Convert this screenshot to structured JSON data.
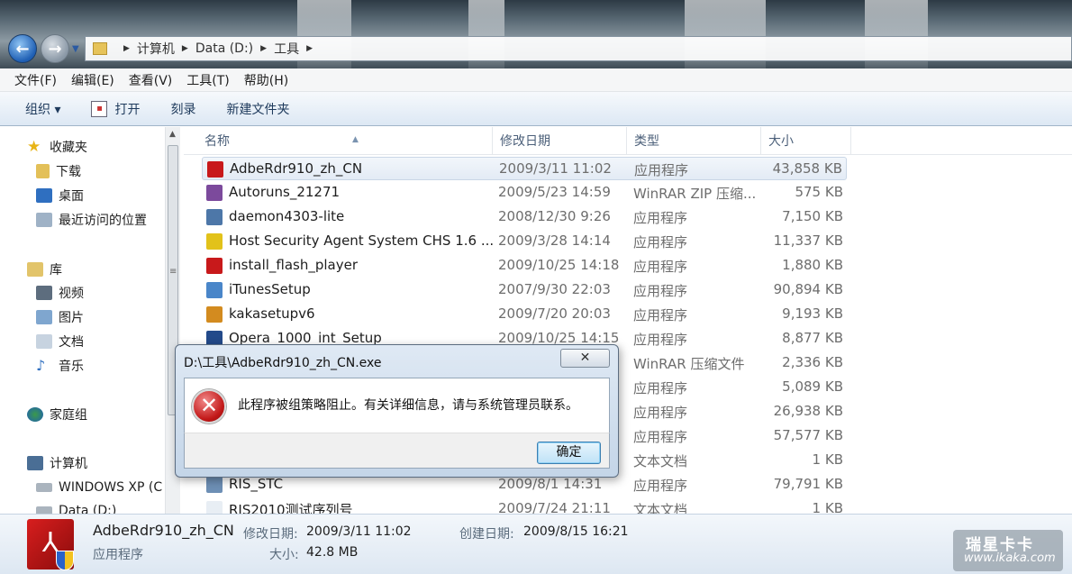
{
  "address_bar": {
    "crumbs": [
      "计算机",
      "Data (D:)",
      "工具"
    ]
  },
  "menu": [
    "文件(F)",
    "编辑(E)",
    "查看(V)",
    "工具(T)",
    "帮助(H)"
  ],
  "toolbar": {
    "organize": "组织 ▾",
    "open": "打开",
    "burn": "刻录",
    "new_folder": "新建文件夹"
  },
  "nav": {
    "favorites": "收藏夹",
    "downloads": "下载",
    "desktop": "桌面",
    "recent": "最近访问的位置",
    "libraries": "库",
    "videos": "视频",
    "pictures": "图片",
    "documents": "文档",
    "music": "音乐",
    "homegroup": "家庭组",
    "computer": "计算机",
    "drive_c": "WINDOWS XP (C",
    "drive_d": "Data (D:)"
  },
  "columns": {
    "name": "名称",
    "date": "修改日期",
    "type": "类型",
    "size": "大小"
  },
  "files": [
    {
      "name": "AdbeRdr910_zh_CN",
      "date": "2009/3/11 11:02",
      "type": "应用程序",
      "size": "43,858 KB"
    },
    {
      "name": "Autoruns_21271",
      "date": "2009/5/23 14:59",
      "type": "WinRAR ZIP 压缩...",
      "size": "575 KB"
    },
    {
      "name": "daemon4303-lite",
      "date": "2008/12/30 9:26",
      "type": "应用程序",
      "size": "7,150 KB"
    },
    {
      "name": "Host Security Agent System CHS 1.6 ...",
      "date": "2009/3/28 14:14",
      "type": "应用程序",
      "size": "11,337 KB"
    },
    {
      "name": "install_flash_player",
      "date": "2009/10/25 14:18",
      "type": "应用程序",
      "size": "1,880 KB"
    },
    {
      "name": "iTunesSetup",
      "date": "2007/9/30 22:03",
      "type": "应用程序",
      "size": "90,894 KB"
    },
    {
      "name": "kakasetupv6",
      "date": "2009/7/20 20:03",
      "type": "应用程序",
      "size": "9,193 KB"
    },
    {
      "name": "Opera_1000_int_Setup",
      "date": "2009/10/25 14:15",
      "type": "应用程序",
      "size": "8,877 KB"
    },
    {
      "name": "",
      "date": "",
      "type": "WinRAR 压缩文件",
      "size": "2,336 KB"
    },
    {
      "name": "",
      "date": "",
      "type": "应用程序",
      "size": "5,089 KB"
    },
    {
      "name": "",
      "date": "",
      "type": "应用程序",
      "size": "26,938 KB"
    },
    {
      "name": "",
      "date": "",
      "type": "应用程序",
      "size": "57,577 KB"
    },
    {
      "name": "",
      "date": "",
      "type": "文本文档",
      "size": "1 KB"
    },
    {
      "name": "RIS_STC",
      "date": "2009/8/1 14:31",
      "type": "应用程序",
      "size": "79,791 KB"
    },
    {
      "name": "RIS2010测试序列号",
      "date": "2009/7/24 21:11",
      "type": "文本文档",
      "size": "1 KB"
    }
  ],
  "details": {
    "name": "AdbeRdr910_zh_CN",
    "type": "应用程序",
    "modified_label": "修改日期:",
    "modified": "2009/3/11 11:02",
    "created_label": "创建日期:",
    "created": "2009/8/15 16:21",
    "size_label": "大小:",
    "size": "42.8 MB"
  },
  "dialog": {
    "title": "D:\\工具\\AdbeRdr910_zh_CN.exe",
    "message": "此程序被组策略阻止。有关详细信息，请与系统管理员联系。",
    "ok": "确定",
    "close": "✕"
  },
  "watermark": {
    "brand": "瑞星卡卡",
    "url": "www.ikaka.com"
  }
}
